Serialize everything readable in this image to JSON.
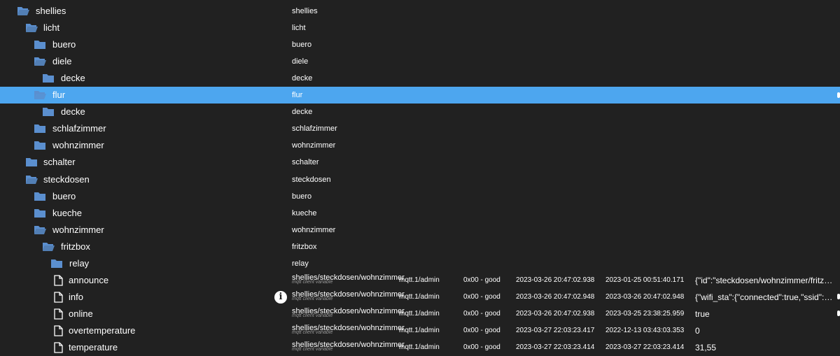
{
  "colors": {
    "background": "#212121",
    "selection": "#4da6ef",
    "folder": "#5b8fcf",
    "subtext": "#9a9a9a"
  },
  "rows": [
    {
      "label": "shellies",
      "name": "shellies",
      "icon": "folder-open-icon"
    },
    {
      "label": "licht",
      "name": "licht",
      "icon": "folder-open-icon"
    },
    {
      "label": "buero",
      "name": "buero",
      "icon": "folder-icon"
    },
    {
      "label": "diele",
      "name": "diele",
      "icon": "folder-open-icon"
    },
    {
      "label": "decke",
      "name": "decke",
      "icon": "folder-icon"
    },
    {
      "label": "flur",
      "name": "flur",
      "icon": "folder-open-icon"
    },
    {
      "label": "decke",
      "name": "decke",
      "icon": "folder-icon"
    },
    {
      "label": "schlafzimmer",
      "name": "schlafzimmer",
      "icon": "folder-icon"
    },
    {
      "label": "wohnzimmer",
      "name": "wohnzimmer",
      "icon": "folder-icon"
    },
    {
      "label": "schalter",
      "name": "schalter",
      "icon": "folder-icon"
    },
    {
      "label": "steckdosen",
      "name": "steckdosen",
      "icon": "folder-open-icon"
    },
    {
      "label": "buero",
      "name": "buero",
      "icon": "folder-icon"
    },
    {
      "label": "kueche",
      "name": "kueche",
      "icon": "folder-icon"
    },
    {
      "label": "wohnzimmer",
      "name": "wohnzimmer",
      "icon": "folder-open-icon"
    },
    {
      "label": "fritzbox",
      "name": "fritzbox",
      "icon": "folder-open-icon"
    },
    {
      "label": "relay",
      "name": "relay",
      "icon": "folder-icon"
    },
    {
      "label": "announce",
      "name": "shellies/steckdosen/wohnzimmer",
      "sub": "mqtt client variable",
      "role": "mqtt.1/admin",
      "quality": "0x00 - good",
      "ts": "2023-03-26 20:47:02.938",
      "lc": "2023-01-25 00:51:40.171",
      "value": "{\"id\":\"steckdosen/wohnzimmer/fritzbox\",\"mode\":\"relay\"}",
      "icon": "file-icon"
    },
    {
      "label": "info",
      "name": "shellies/steckdosen/wohnzimmer",
      "sub": "mqtt client variable",
      "role": "mqtt.1/admin",
      "quality": "0x00 - good",
      "ts": "2023-03-26 20:47:02.948",
      "lc": "2023-03-26 20:47:02.948",
      "value": "{\"wifi_sta\":{\"connected\":true,\"ssid\":\"FRITZ!Box\"}}",
      "icon": "file-icon",
      "info": "i"
    },
    {
      "label": "online",
      "name": "shellies/steckdosen/wohnzimmer",
      "sub": "mqtt client variable",
      "role": "mqtt.1/admin",
      "quality": "0x00 - good",
      "ts": "2023-03-26 20:47:02.938",
      "lc": "2023-03-25 23:38:25.959",
      "value": "true",
      "icon": "file-icon"
    },
    {
      "label": "overtemperature",
      "name": "shellies/steckdosen/wohnzimmer",
      "sub": "mqtt client variable",
      "role": "mqtt.1/admin",
      "quality": "0x00 - good",
      "ts": "2023-03-27 22:03:23.417",
      "lc": "2022-12-13 03:43:03.353",
      "value": "0",
      "icon": "file-icon"
    },
    {
      "label": "temperature",
      "name": "shellies/steckdosen/wohnzimmer",
      "sub": "mqtt client variable",
      "role": "mqtt.1/admin",
      "quality": "0x00 - good",
      "ts": "2023-03-27 22:03:23.414",
      "lc": "2023-03-27 22:03:23.414",
      "value": "31,55",
      "icon": "file-icon"
    }
  ]
}
